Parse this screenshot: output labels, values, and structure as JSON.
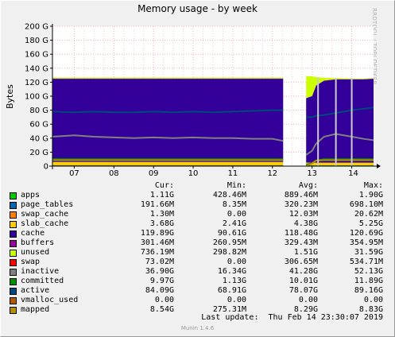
{
  "title": "Memory usage - by week",
  "watermark": "RRDTOOL / TOBI OETIKER",
  "ylabel": "Bytes",
  "legend_headers": {
    "cur": "Cur:",
    "min": "Min:",
    "avg": "Avg:",
    "max": "Max:"
  },
  "legend": [
    {
      "name": "apps",
      "color": "#00cc00",
      "cur": "1.11G",
      "min": "428.46M",
      "avg": "889.46M",
      "max": "1.90G"
    },
    {
      "name": "page_tables",
      "color": "#0066b3",
      "cur": "191.66M",
      "min": "8.35M",
      "avg": "320.23M",
      "max": "698.10M"
    },
    {
      "name": "swap_cache",
      "color": "#ff8000",
      "cur": "1.30M",
      "min": "0.00",
      "avg": "12.03M",
      "max": "20.62M"
    },
    {
      "name": "slab_cache",
      "color": "#ffcc00",
      "cur": "3.68G",
      "min": "2.41G",
      "avg": "4.38G",
      "max": "5.25G"
    },
    {
      "name": "cache",
      "color": "#330099",
      "cur": "119.89G",
      "min": "90.61G",
      "avg": "118.48G",
      "max": "120.69G"
    },
    {
      "name": "buffers",
      "color": "#990099",
      "cur": "301.46M",
      "min": "260.95M",
      "avg": "329.43M",
      "max": "354.95M"
    },
    {
      "name": "unused",
      "color": "#ccff00",
      "cur": "736.19M",
      "min": "298.82M",
      "avg": "1.51G",
      "max": "31.59G"
    },
    {
      "name": "swap",
      "color": "#ff0000",
      "cur": "73.02M",
      "min": "0.00",
      "avg": "306.65M",
      "max": "534.71M"
    },
    {
      "name": "inactive",
      "color": "#808080",
      "cur": "36.90G",
      "min": "16.34G",
      "avg": "41.28G",
      "max": "52.13G"
    },
    {
      "name": "committed",
      "color": "#008f00",
      "cur": "9.97G",
      "min": "1.13G",
      "avg": "10.01G",
      "max": "11.89G"
    },
    {
      "name": "active",
      "color": "#00487d",
      "cur": "84.09G",
      "min": "68.91G",
      "avg": "78.07G",
      "max": "89.16G"
    },
    {
      "name": "vmalloc_used",
      "color": "#b35a00",
      "cur": "0.00",
      "min": "0.00",
      "avg": "0.00",
      "max": "0.00"
    },
    {
      "name": "mapped",
      "color": "#b38f00",
      "cur": "8.54G",
      "min": "275.31M",
      "avg": "8.29G",
      "max": "8.83G"
    }
  ],
  "last_update": "Last update:  Thu Feb 14 23:30:07 2019",
  "footer_version": "Munin 1.4.6",
  "chart_data": {
    "type": "area",
    "title": "Memory usage - by week",
    "ylabel": "Bytes",
    "ylim": [
      0,
      200
    ],
    "yunit": "G",
    "yticks": [
      "0",
      "20 G",
      "40 G",
      "60 G",
      "80 G",
      "100 G",
      "120 G",
      "140 G",
      "160 G",
      "180 G",
      "200 G"
    ],
    "ytick_values": [
      0,
      20,
      40,
      60,
      80,
      100,
      120,
      140,
      160,
      180,
      200
    ],
    "xticks": [
      "07",
      "08",
      "09",
      "10",
      "11",
      "12",
      "13",
      "14"
    ],
    "xlim": [
      6.45,
      14.55
    ],
    "xtick_values": [
      7,
      8,
      9,
      10,
      11,
      12,
      13,
      14
    ],
    "grid": true,
    "gap": [
      12.27,
      12.85
    ],
    "x": [
      6.45,
      7,
      7.5,
      8,
      8.5,
      9,
      9.5,
      10,
      10.5,
      11,
      11.5,
      12,
      12.27,
      12.85,
      13,
      13.1,
      13.3,
      13.6,
      14,
      14.3,
      14.55
    ],
    "series": [
      {
        "name": "apps",
        "values": [
          1.1,
          1.1,
          1.1,
          1.1,
          1.1,
          1.1,
          1.1,
          1.1,
          1.1,
          1.1,
          1.1,
          1.1,
          1.1,
          1.1,
          1.1,
          1.1,
          1.1,
          1.1,
          1.1,
          1.1,
          1.1
        ]
      },
      {
        "name": "page_tables",
        "values": [
          0.3,
          0.3,
          0.3,
          0.3,
          0.3,
          0.3,
          0.3,
          0.3,
          0.3,
          0.3,
          0.3,
          0.3,
          0.3,
          0.2,
          0.2,
          0.2,
          0.2,
          0.2,
          0.2,
          0.2,
          0.2
        ]
      },
      {
        "name": "slab_cache",
        "values": [
          4.5,
          4.5,
          4.5,
          4.5,
          4.5,
          4.5,
          4.5,
          4.5,
          4.5,
          4.5,
          4.5,
          4.5,
          4.5,
          3.7,
          3.7,
          3.7,
          3.7,
          3.7,
          3.7,
          3.7,
          3.7
        ]
      },
      {
        "name": "cache",
        "values": [
          119,
          119,
          119,
          119,
          119,
          119,
          119,
          119,
          119,
          119,
          119,
          119,
          119,
          92,
          95,
          110,
          117,
          119,
          119,
          119,
          119.9
        ]
      },
      {
        "name": "buffers",
        "values": [
          0.33,
          0.33,
          0.33,
          0.33,
          0.33,
          0.33,
          0.33,
          0.33,
          0.33,
          0.33,
          0.33,
          0.33,
          0.33,
          0.3,
          0.3,
          0.3,
          0.3,
          0.3,
          0.3,
          0.3,
          0.3
        ]
      },
      {
        "name": "unused",
        "values": [
          1.5,
          1.5,
          1.5,
          1.5,
          1.5,
          1.5,
          1.5,
          1.5,
          1.5,
          1.5,
          1.5,
          1.5,
          1.5,
          31.5,
          28,
          12,
          4,
          1.5,
          1,
          0.8,
          0.7
        ]
      }
    ],
    "lines": [
      {
        "name": "inactive",
        "values": [
          42,
          44,
          42,
          41,
          40,
          41,
          40,
          41,
          40,
          40,
          39,
          39,
          36,
          16,
          22,
          32,
          42,
          46,
          42,
          39,
          37
        ]
      },
      {
        "name": "committed",
        "values": [
          10,
          10,
          10,
          10,
          10,
          10,
          10,
          10,
          10,
          10,
          10,
          10,
          10,
          2,
          4,
          8,
          10,
          10,
          10,
          10,
          10
        ]
      },
      {
        "name": "active",
        "values": [
          78,
          77,
          78,
          77,
          77,
          78,
          77,
          78,
          77,
          78,
          79,
          80,
          80,
          70,
          70,
          72,
          73,
          76,
          80,
          82,
          84
        ]
      },
      {
        "name": "mapped",
        "values": [
          8.5,
          8.5,
          8.5,
          8.5,
          8.5,
          8.5,
          8.5,
          8.5,
          8.5,
          8.5,
          8.5,
          8.5,
          8.5,
          0.3,
          4,
          8,
          8.5,
          8.5,
          8.5,
          8.5,
          8.5
        ]
      },
      {
        "name": "swap",
        "values": [
          0.3,
          0.3,
          0.3,
          0.3,
          0.3,
          0.3,
          0.3,
          0.3,
          0.3,
          0.3,
          0.3,
          0.3,
          0.3,
          0,
          0.1,
          0.1,
          0.1,
          0.1,
          0.1,
          0.1,
          0.1
        ]
      }
    ]
  }
}
